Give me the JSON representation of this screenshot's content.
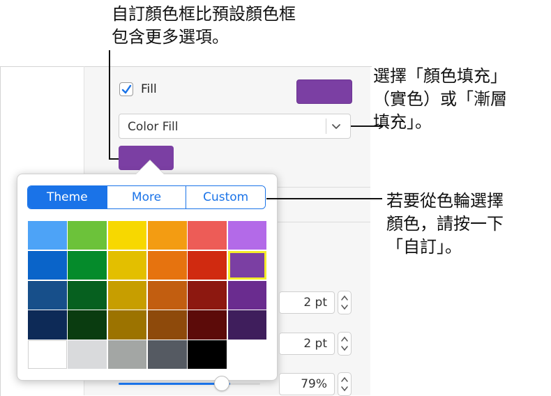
{
  "callouts": {
    "top": "自訂顏色框比預設顏色框\n包含更多選項。",
    "right_fill_type": "選擇「顏色填充」\n（實色）或「漸層\n填充」。",
    "right_custom": "若要從色輪選擇\n顏色，請按一下\n「自訂」。"
  },
  "fill": {
    "checkbox_label": "Fill",
    "checked": true,
    "swatch_color": "#7b3fa3",
    "type_select_value": "Color Fill",
    "color_well_color": "#7b3fa3"
  },
  "popover": {
    "tabs": [
      {
        "label": "Theme",
        "active": true
      },
      {
        "label": "More",
        "active": false
      },
      {
        "label": "Custom",
        "active": false
      }
    ],
    "swatches": [
      [
        "#4da3f7",
        "#6cc23a",
        "#f7d800",
        "#f39c12",
        "#ed5c57",
        "#b36ae8"
      ],
      [
        "#0a64c9",
        "#058b2b",
        "#e3bf00",
        "#e6730f",
        "#d02a10",
        "#7b3fa3"
      ],
      [
        "#174f8a",
        "#06601f",
        "#c79e00",
        "#c25e10",
        "#8d1810",
        "#6a2c8f"
      ],
      [
        "#0d2a57",
        "#0a3c10",
        "#9c7300",
        "#8e4a0b",
        "#5c0b09",
        "#3f1e5c"
      ],
      [
        "#ffffff",
        "#d9dadc",
        "#a3a6a4",
        "#555a62",
        "#000000"
      ]
    ],
    "selected_swatch": [
      1,
      5
    ]
  },
  "steppers": [
    {
      "value": "2 pt"
    },
    {
      "value": "2 pt"
    },
    {
      "value": "79%"
    }
  ],
  "opacity": {
    "value": 0.79
  },
  "colors": {
    "accent": "#1a73e8",
    "selection_outline": "#f4ec2b"
  }
}
